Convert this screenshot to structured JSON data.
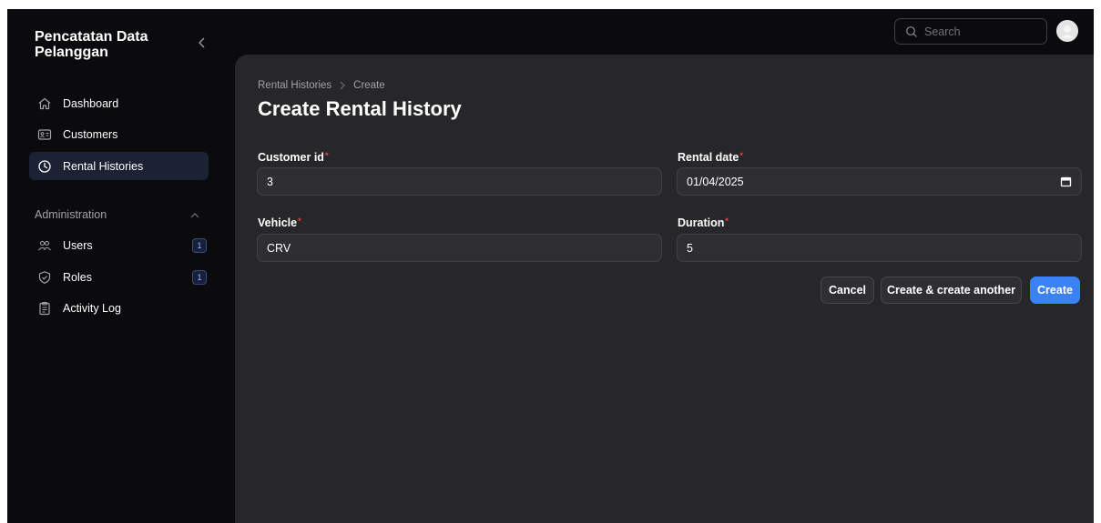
{
  "sidebar": {
    "brand": "Pencatatan Data Pelanggan",
    "items": [
      {
        "label": "Dashboard",
        "icon": "home-icon"
      },
      {
        "label": "Customers",
        "icon": "id-card-icon"
      },
      {
        "label": "Rental Histories",
        "icon": "clock-icon",
        "active": true
      }
    ],
    "group": {
      "label": "Administration",
      "items": [
        {
          "label": "Users",
          "icon": "users-icon",
          "badge": "1"
        },
        {
          "label": "Roles",
          "icon": "shield-check-icon",
          "badge": "1"
        },
        {
          "label": "Activity Log",
          "icon": "clipboard-icon"
        }
      ]
    }
  },
  "topbar": {
    "search_placeholder": "Search"
  },
  "breadcrumb": {
    "parent": "Rental Histories",
    "current": "Create"
  },
  "page": {
    "title": "Create Rental History"
  },
  "form": {
    "customer_id": {
      "label": "Customer id",
      "value": "3"
    },
    "rental_date": {
      "label": "Rental date",
      "value": "01/04/2025"
    },
    "vehicle": {
      "label": "Vehicle",
      "value": "CRV"
    },
    "duration": {
      "label": "Duration",
      "value": "5"
    },
    "required_mark": "*"
  },
  "actions": {
    "cancel": "Cancel",
    "create_another": "Create & create another",
    "create": "Create"
  },
  "colors": {
    "background": "#0b0b0e",
    "panel": "#27272a",
    "accent": "#3b82f6",
    "active_nav": "#1c2233",
    "required": "#ef4444"
  }
}
